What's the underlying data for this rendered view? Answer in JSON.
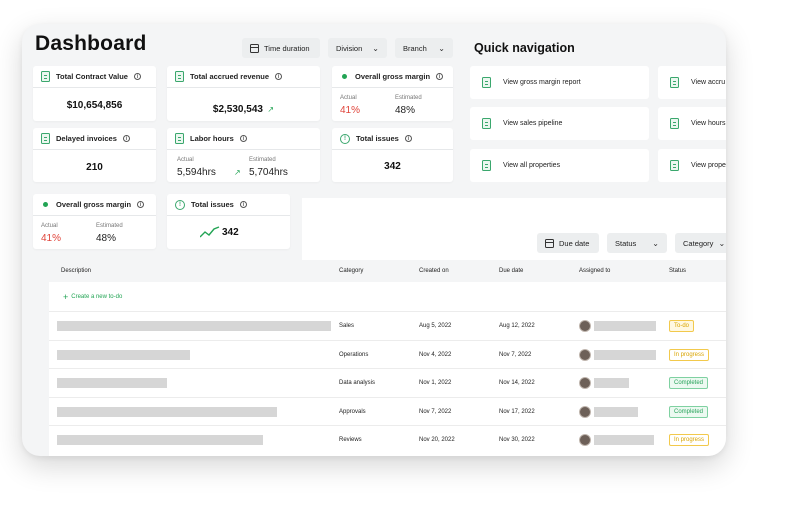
{
  "header": {
    "title": "Dashboard"
  },
  "filters": {
    "time": "Time duration",
    "division": "Division",
    "branch": "Branch"
  },
  "kpis": {
    "contract": {
      "label": "Total Contract Value",
      "value": "$10,654,856"
    },
    "revenue": {
      "label": "Total accrued revenue",
      "value": "$2,530,543"
    },
    "margin1": {
      "label": "Overall gross margin",
      "actual_label": "Actual",
      "actual": "41%",
      "est_label": "Estimated",
      "estimated": "48%"
    },
    "delayed": {
      "label": "Delayed invoices",
      "value": "210"
    },
    "labor": {
      "label": "Labor hours",
      "actual_label": "Actual",
      "actual": "5,594hrs",
      "est_label": "Estimated",
      "estimated": "5,704hrs"
    },
    "issues1": {
      "label": "Total issues",
      "value": "342"
    },
    "margin2": {
      "label": "Overall gross margin",
      "actual_label": "Actual",
      "actual": "41%",
      "est_label": "Estimated",
      "estimated": "48%"
    },
    "issues2": {
      "label": "Total issues",
      "value": "342"
    }
  },
  "quick_nav": {
    "title": "Quick navigation",
    "items": [
      "View gross margin report",
      "View accru",
      "View sales pipeline",
      "View hours",
      "View all properties",
      "View prope"
    ]
  },
  "table_filters": {
    "due": "Due date",
    "status": "Status",
    "category": "Category"
  },
  "table": {
    "headers": [
      "Description",
      "Category",
      "Created on",
      "Due date",
      "Assigned to",
      "Status"
    ],
    "create_label": "Create a new to-do",
    "rows": [
      {
        "category": "Sales",
        "created": "Aug 5, 2022",
        "due": "Aug 12, 2022",
        "status": "To-do"
      },
      {
        "category": "Operations",
        "created": "Nov 4, 2022",
        "due": "Nov 7, 2022",
        "status": "In progress"
      },
      {
        "category": "Data analysis",
        "created": "Nov 1, 2022",
        "due": "Nov 14, 2022",
        "status": "Completed"
      },
      {
        "category": "Approvals",
        "created": "Nov 7, 2022",
        "due": "Nov 17, 2022",
        "status": "Completed"
      },
      {
        "category": "Reviews",
        "created": "Nov 20, 2022",
        "due": "Nov 30, 2022",
        "status": "In progress"
      }
    ]
  },
  "colors": {
    "accent": "#22a454",
    "negative": "#e0443a",
    "todo": "#d9a400",
    "completed": "#27a35a"
  }
}
